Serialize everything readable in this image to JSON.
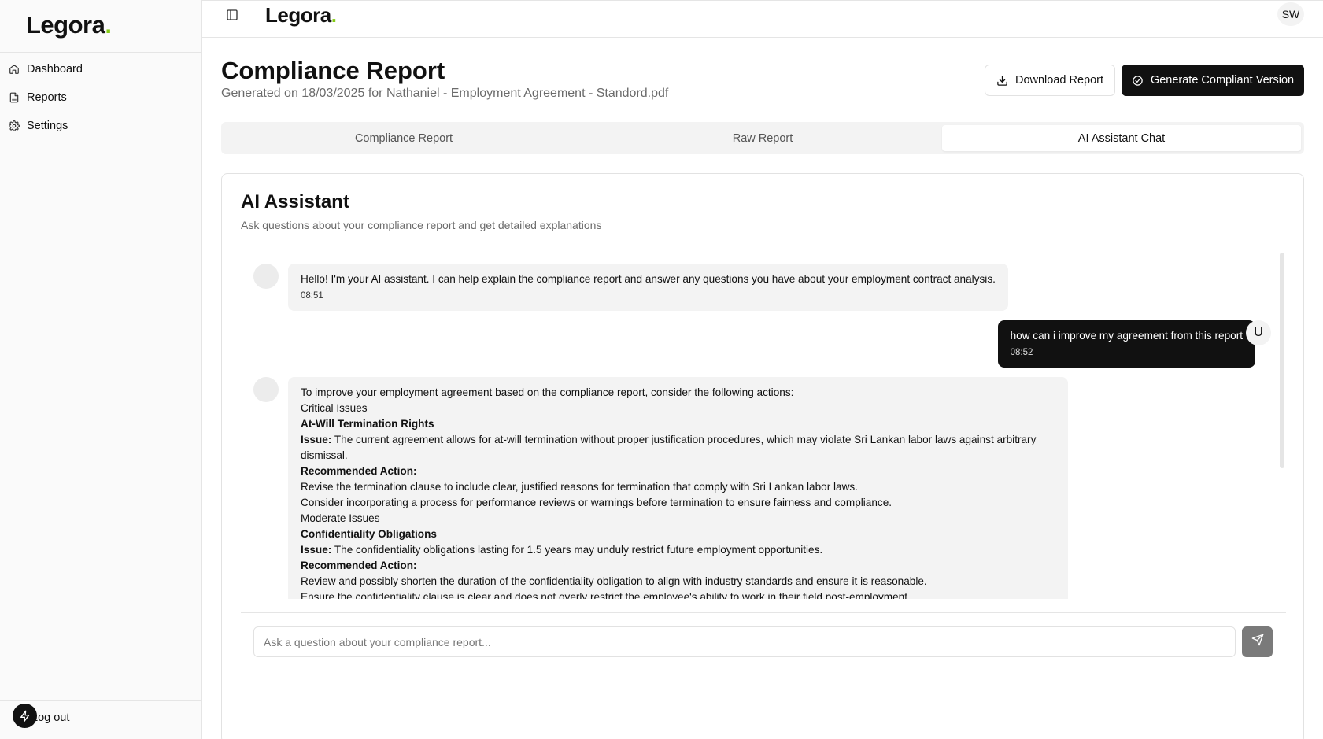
{
  "sidebar": {
    "logo_text": "Legora",
    "logo_dot": ".",
    "items": [
      {
        "label": "Dashboard",
        "icon": "home-icon"
      },
      {
        "label": "Reports",
        "icon": "file-icon"
      },
      {
        "label": "Settings",
        "icon": "gear-icon"
      }
    ],
    "logout_label": "Log out"
  },
  "topbar": {
    "logo_text": "Legora",
    "logo_dot": ".",
    "avatar_initials": "SW"
  },
  "header": {
    "title": "Compliance Report",
    "subtitle": "Generated on 18/03/2025 for Nathaniel - Employment Agreement - Standord.pdf",
    "download_label": "Download Report",
    "generate_label": "Generate Compliant Version"
  },
  "tabs": [
    {
      "label": "Compliance Report",
      "active": false
    },
    {
      "label": "Raw Report",
      "active": false
    },
    {
      "label": "AI Assistant Chat",
      "active": true
    }
  ],
  "assistant": {
    "title": "AI Assistant",
    "subtitle": "Ask questions about your compliance report and get detailed explanations",
    "messages": [
      {
        "role": "assistant",
        "text": "Hello! I'm your AI assistant. I can help explain the compliance report and answer any questions you have about your employment contract analysis.",
        "time": "08:51"
      },
      {
        "role": "user",
        "avatar": "U",
        "text": "how can i improve my agreement from this report",
        "time": "08:52"
      },
      {
        "role": "assistant",
        "lines": {
          "intro": "To improve your employment agreement based on the compliance report, consider the following actions:",
          "critical": "Critical Issues",
          "h1": "At-Will Termination Rights",
          "issue_label": "Issue:",
          "issue1": " The current agreement allows for at-will termination without proper justification procedures, which may violate Sri Lankan labor laws against arbitrary dismissal.",
          "action_label": "Recommended Action:",
          "a1_1": "Revise the termination clause to include clear, justified reasons for termination that comply with Sri Lankan labor laws.",
          "a1_2": "Consider incorporating a process for performance reviews or warnings before termination to ensure fairness and compliance.",
          "moderate": "Moderate Issues",
          "h2": "Confidentiality Obligations",
          "issue2": " The confidentiality obligations lasting for 1.5 years may unduly restrict future employment opportunities.",
          "a2_1": "Review and possibly shorten the duration of the confidentiality obligation to align with industry standards and ensure it is reasonable.",
          "a2_2": "Ensure the confidentiality clause is clear and does not overly restrict the employee's ability to work in their field post-employment."
        }
      }
    ],
    "input_placeholder": "Ask a question about your compliance report..."
  },
  "colors": {
    "accent_dot": "#84cc16",
    "primary_button": "#111111",
    "send_button": "#7a7a7a"
  }
}
